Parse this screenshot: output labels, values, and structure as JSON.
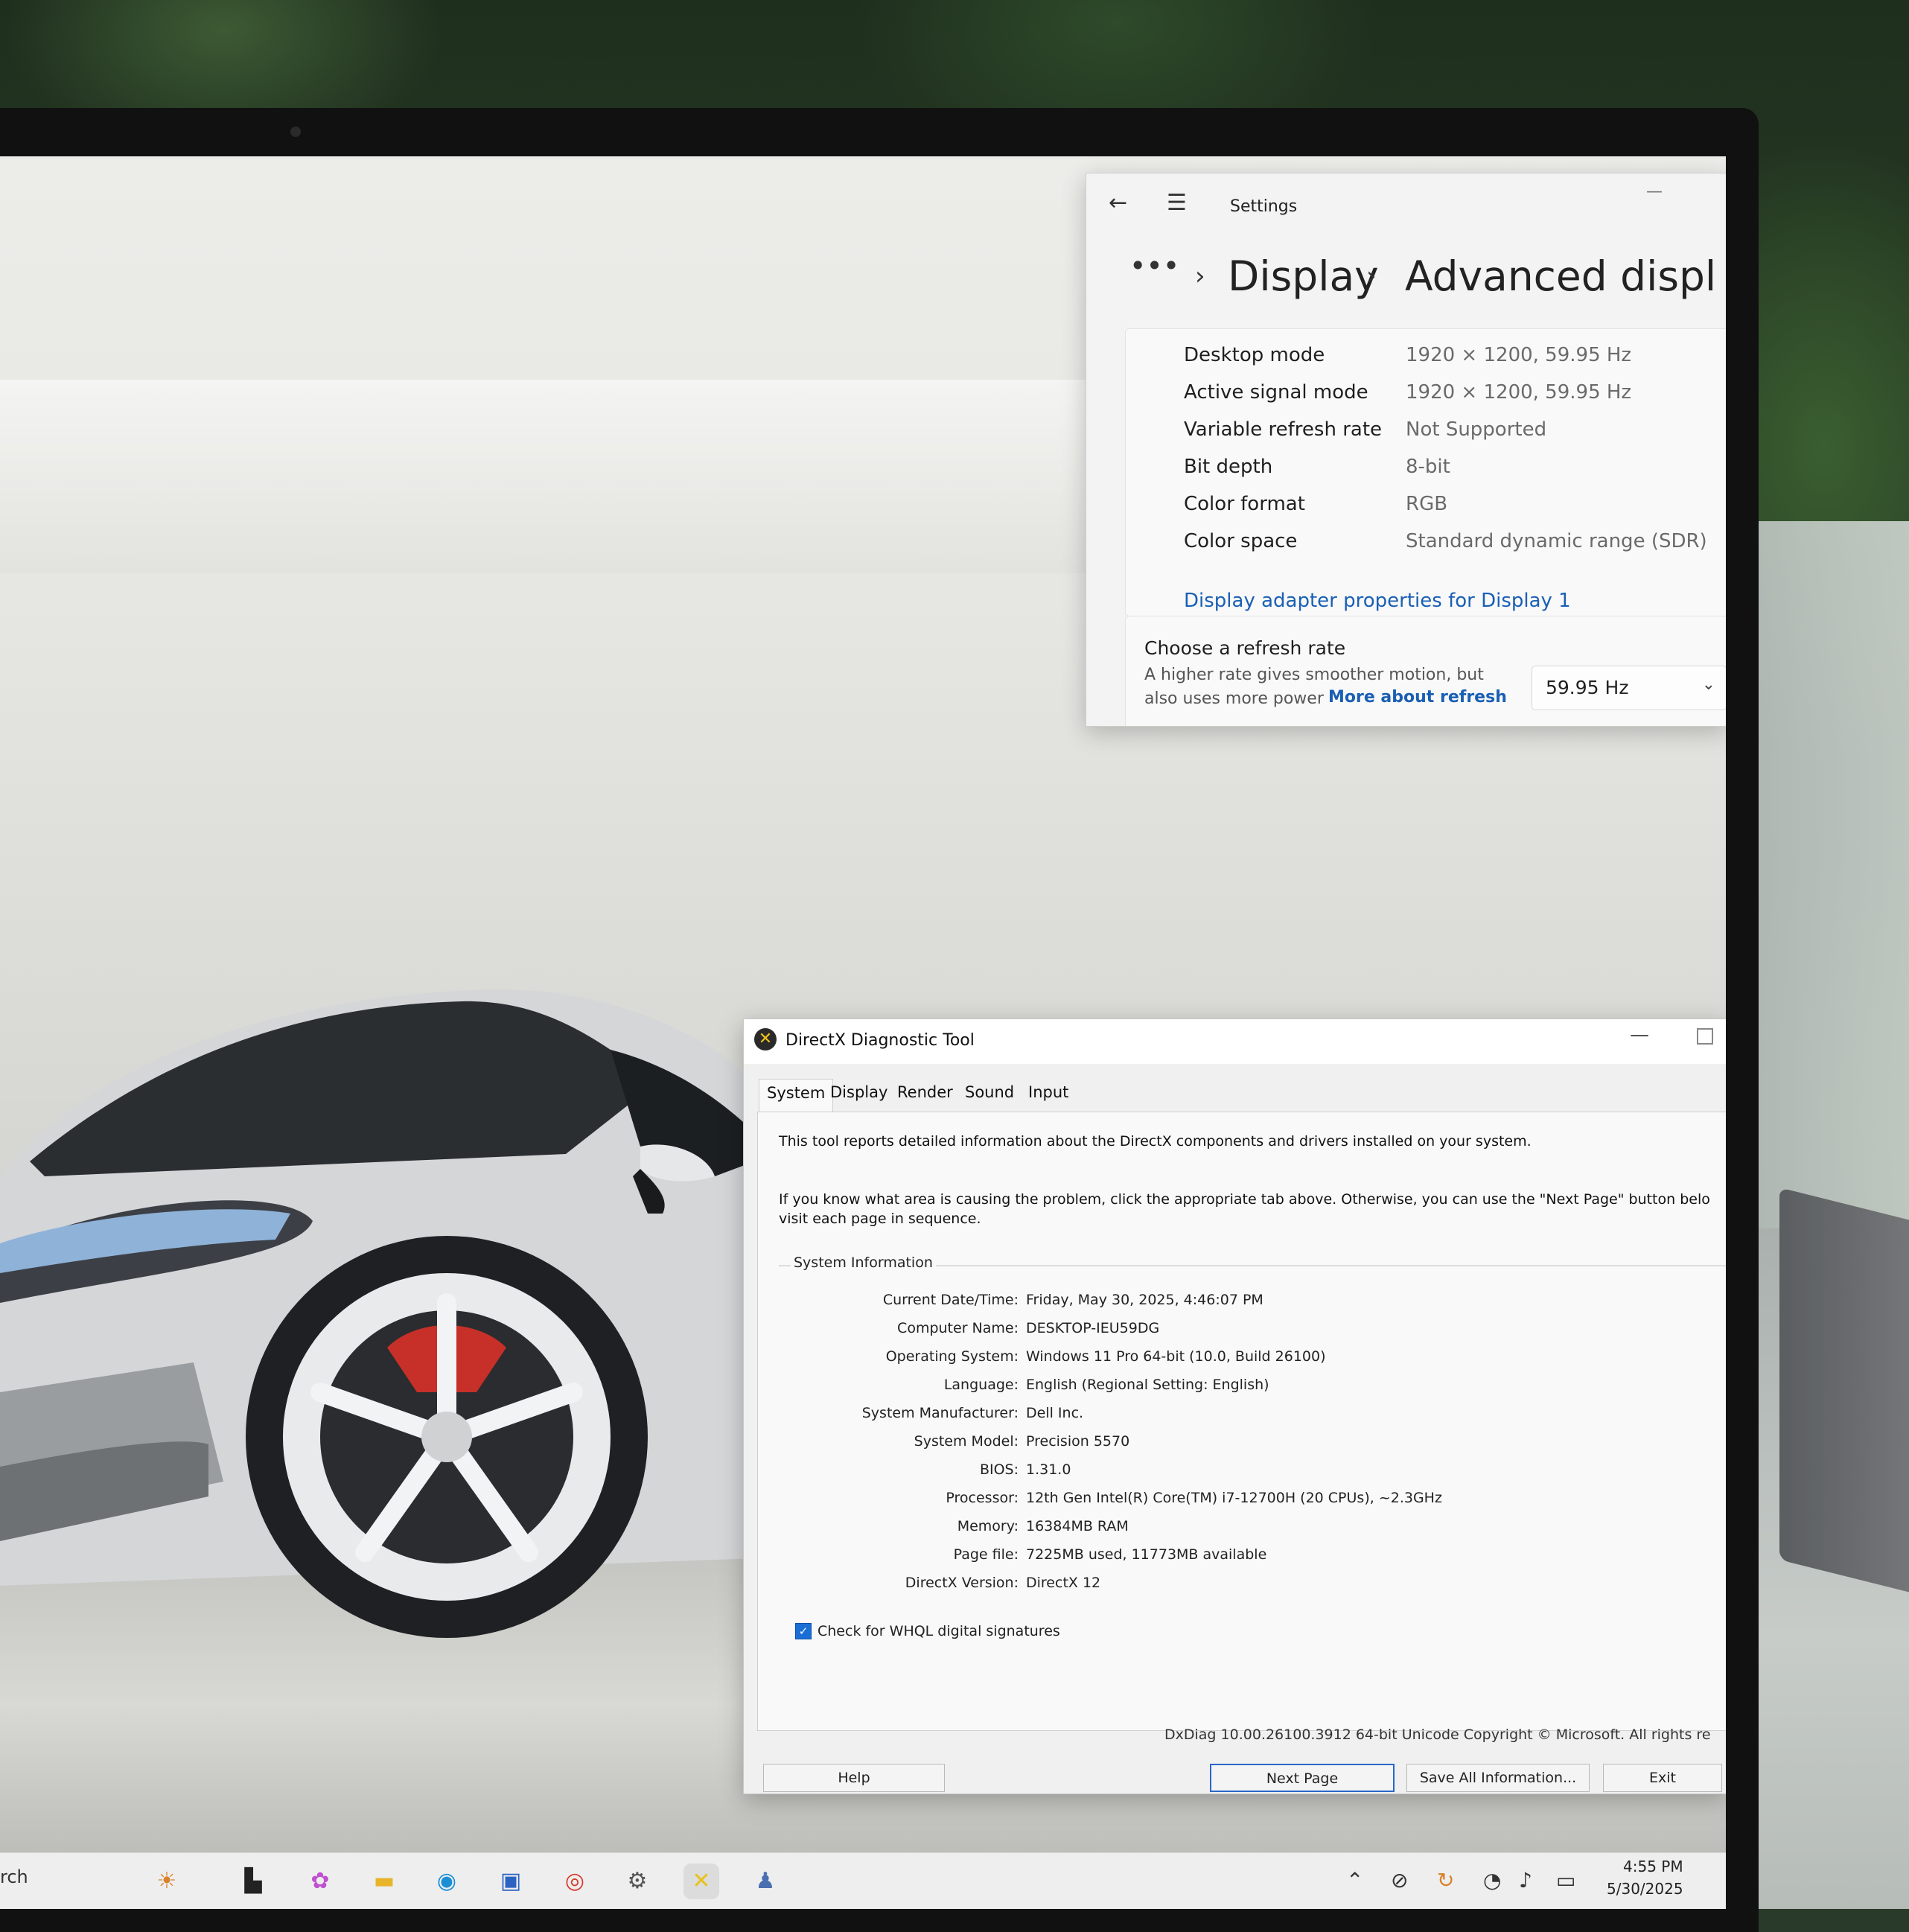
{
  "settings": {
    "title": "Settings",
    "breadcrumb": {
      "more": "•••",
      "display": "Display",
      "current": "Advanced displ"
    },
    "rows": [
      {
        "label": "Desktop mode",
        "value": "1920 × 1200, 59.95 Hz"
      },
      {
        "label": "Active signal mode",
        "value": "1920 × 1200, 59.95 Hz"
      },
      {
        "label": "Variable refresh rate",
        "value": "Not Supported"
      },
      {
        "label": "Bit depth",
        "value": "8-bit"
      },
      {
        "label": "Color format",
        "value": "RGB"
      },
      {
        "label": "Color space",
        "value": "Standard dynamic range (SDR)"
      }
    ],
    "adapter_link": "Display adapter properties for Display 1",
    "refresh": {
      "title": "Choose a refresh rate",
      "desc_line1": "A higher rate gives smoother motion, but",
      "desc_line2": "also uses more power",
      "more_link": "More about refresh",
      "selected": "59.95 Hz"
    }
  },
  "dxdiag": {
    "title": "DirectX Diagnostic Tool",
    "tabs": [
      "System",
      "Display",
      "Render",
      "Sound",
      "Input"
    ],
    "intro1": "This tool reports detailed information about the DirectX components and drivers installed on your system.",
    "intro2_line1": "If you know what area is causing the problem, click the appropriate tab above.  Otherwise, you can use the \"Next Page\" button belo",
    "intro2_line2": "visit each page in sequence.",
    "group_title": "System Information",
    "info": [
      {
        "key": "Current Date/Time:",
        "value": "Friday, May 30, 2025, 4:46:07 PM"
      },
      {
        "key": "Computer Name:",
        "value": "DESKTOP-IEU59DG"
      },
      {
        "key": "Operating System:",
        "value": "Windows 11 Pro 64-bit (10.0, Build 26100)"
      },
      {
        "key": "Language:",
        "value": "English (Regional Setting: English)"
      },
      {
        "key": "System Manufacturer:",
        "value": "Dell Inc."
      },
      {
        "key": "System Model:",
        "value": "Precision 5570"
      },
      {
        "key": "BIOS:",
        "value": "1.31.0"
      },
      {
        "key": "Processor:",
        "value": "12th Gen Intel(R) Core(TM) i7-12700H (20 CPUs), ~2.3GHz"
      },
      {
        "key": "Memory:",
        "value": "16384MB RAM"
      },
      {
        "key": "Page file:",
        "value": "7225MB used, 11773MB available"
      },
      {
        "key": "DirectX Version:",
        "value": "DirectX 12"
      }
    ],
    "whql_label": "Check for WHQL digital signatures",
    "footer": "DxDiag 10.00.26100.3912 64-bit Unicode  Copyright © Microsoft. All rights re",
    "buttons": {
      "help": "Help",
      "next": "Next Page",
      "save": "Save All Information...",
      "exit": "Exit"
    }
  },
  "taskbar": {
    "search": "rch",
    "time": "4:55 PM",
    "date": "5/30/2025"
  }
}
